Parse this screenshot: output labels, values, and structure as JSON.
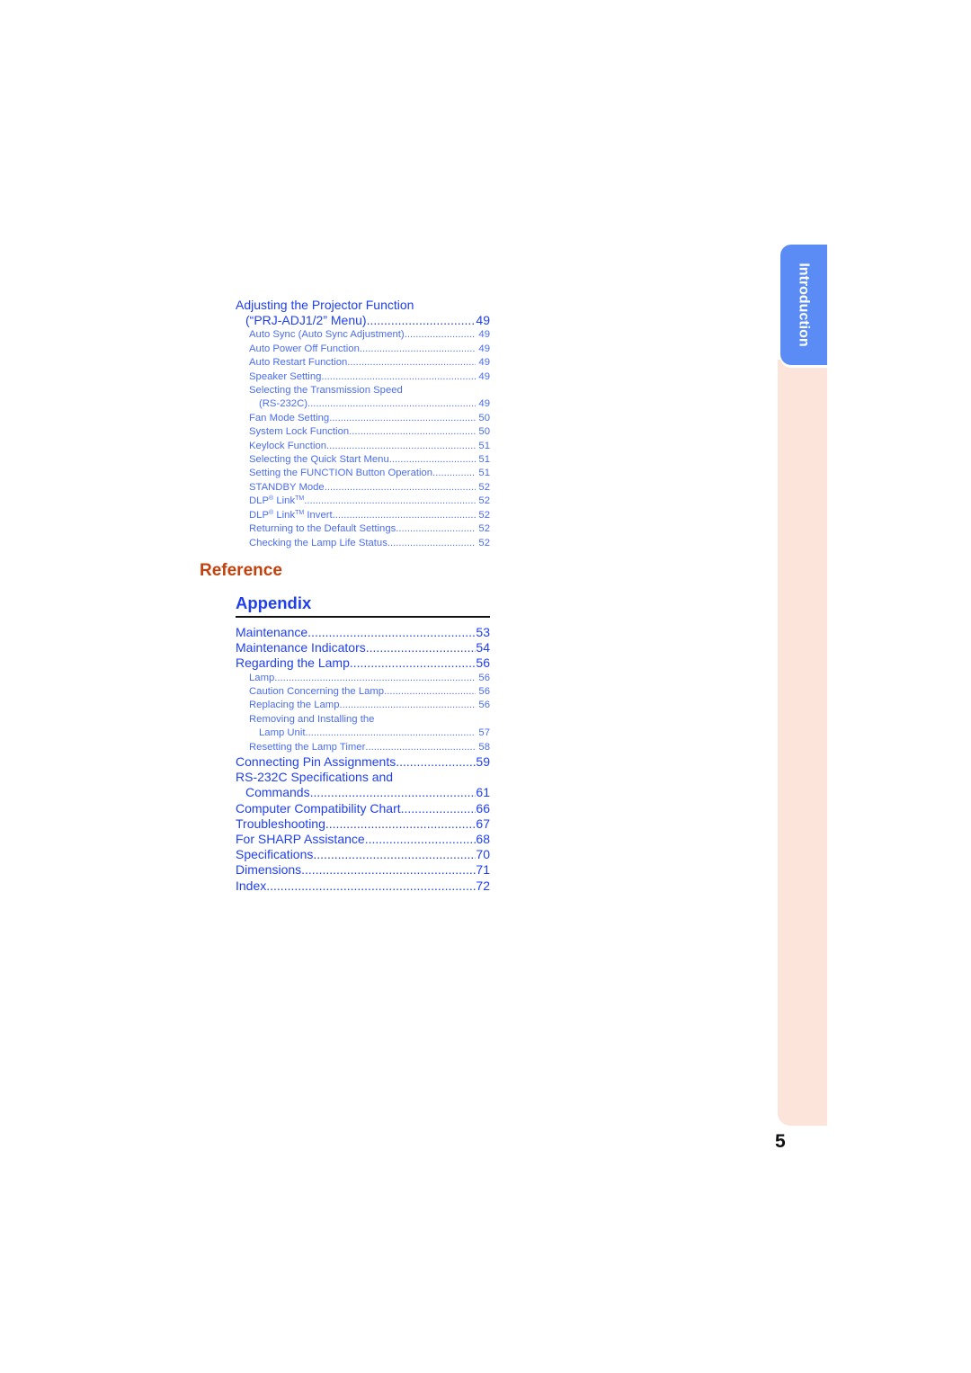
{
  "section_projector": {
    "heading_line1": "Adjusting the Projector Function",
    "heading_line2": "(“PRJ-ADJ1/2” Menu)",
    "heading_page": "49",
    "items": [
      {
        "title": "Auto Sync (Auto Sync Adjustment)",
        "page": "49"
      },
      {
        "title": "Auto Power Off Function",
        "page": "49"
      },
      {
        "title": "Auto Restart Function",
        "page": "49"
      },
      {
        "title": "Speaker Setting",
        "page": "49"
      },
      {
        "title_line1": "Selecting the Transmission Speed",
        "title_line2": "(RS-232C)",
        "page": "49"
      },
      {
        "title": "Fan Mode Setting",
        "page": "50"
      },
      {
        "title": "System Lock Function",
        "page": "50"
      },
      {
        "title": "Keylock Function",
        "page": "51"
      },
      {
        "title": "Selecting the Quick Start Menu",
        "page": "51"
      },
      {
        "title": "Setting the FUNCTION Button Operation.",
        "page": "51"
      },
      {
        "title": "STANDBY Mode",
        "page": "52"
      },
      {
        "title": "DLP® Link™",
        "page": "52"
      },
      {
        "title": "DLP® Link™ Invert",
        "page": "52"
      },
      {
        "title": "Returning to the Default Settings",
        "page": "52"
      },
      {
        "title": "Checking the Lamp Life Status",
        "page": "52"
      }
    ]
  },
  "reference_heading": "Reference",
  "appendix": {
    "heading": "Appendix",
    "entries": [
      {
        "title": "Maintenance",
        "page": "53"
      },
      {
        "title": "Maintenance Indicators",
        "page": "54"
      },
      {
        "title": "Regarding the Lamp",
        "page": "56"
      }
    ],
    "lamp_items": [
      {
        "title": "Lamp",
        "page": "56"
      },
      {
        "title": "Caution Concerning the Lamp",
        "page": "56"
      },
      {
        "title": "Replacing the Lamp",
        "page": "56"
      },
      {
        "title_line1": "Removing and Installing the",
        "title_line2": "Lamp Unit",
        "page": "57"
      },
      {
        "title": "Resetting the Lamp Timer",
        "page": "58"
      }
    ],
    "entries2": [
      {
        "title": "Connecting Pin Assignments",
        "page": "59"
      },
      {
        "title_line1": "RS-232C Specifications and",
        "title_line2": "Commands",
        "page": "61"
      },
      {
        "title": "Computer Compatibility Chart",
        "page": "66"
      },
      {
        "title": "Troubleshooting",
        "page": "67"
      },
      {
        "title": "For SHARP Assistance",
        "page": "68"
      },
      {
        "title": "Specifications",
        "page": "70"
      },
      {
        "title": "Dimensions",
        "page": "71"
      },
      {
        "title": "Index",
        "page": "72"
      }
    ]
  },
  "side_tab": {
    "label": "Introduction",
    "color": "#5b8cf5",
    "band_color": "#fde4da"
  },
  "page_number": "5"
}
